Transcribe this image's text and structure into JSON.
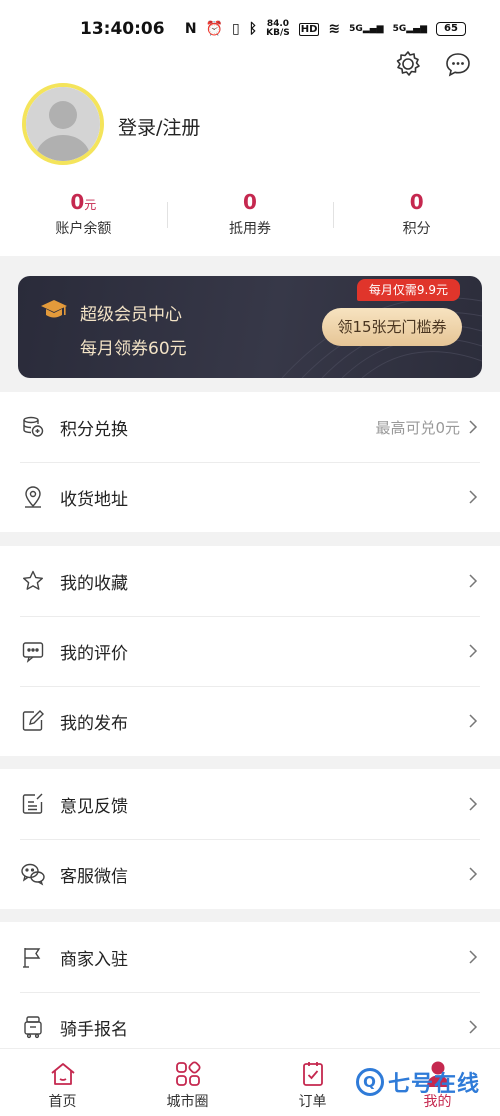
{
  "status": {
    "time": "13:40:06",
    "speed_top": "84.0",
    "speed_bottom": "KB/S",
    "network1": "5G",
    "network2": "5G",
    "battery": "65",
    "hd": "HD"
  },
  "profile": {
    "login_label": "登录/注册",
    "stats": [
      {
        "value": "0",
        "unit": "元",
        "label": "账户余额"
      },
      {
        "value": "0",
        "unit": "",
        "label": "抵用券"
      },
      {
        "value": "0",
        "unit": "",
        "label": "积分"
      }
    ]
  },
  "vip": {
    "title": "超级会员中心",
    "subtitle": "每月领券60元",
    "badge": "每月仅需9.9元",
    "button": "领15张无门槛券"
  },
  "groups": {
    "g1": [
      {
        "label": "积分兑换",
        "extra": "最高可兑0元",
        "icon": "coins-icon"
      },
      {
        "label": "收货地址",
        "extra": "",
        "icon": "location-icon"
      }
    ],
    "g2": [
      {
        "label": "我的收藏",
        "icon": "star-icon"
      },
      {
        "label": "我的评价",
        "icon": "comment-icon"
      },
      {
        "label": "我的发布",
        "icon": "edit-icon"
      }
    ],
    "g3": [
      {
        "label": "意见反馈",
        "icon": "feedback-icon"
      },
      {
        "label": "客服微信",
        "icon": "wechat-icon"
      }
    ],
    "g4": [
      {
        "label": "商家入驻",
        "icon": "flag-icon"
      },
      {
        "label": "骑手报名",
        "icon": "rider-icon"
      }
    ]
  },
  "nav": [
    {
      "label": "首页",
      "icon": "home-icon"
    },
    {
      "label": "城市圈",
      "icon": "city-circle-icon"
    },
    {
      "label": "订单",
      "icon": "order-icon"
    },
    {
      "label": "我的",
      "icon": "profile-icon"
    }
  ],
  "watermark": {
    "q": "Q",
    "text": "七号在线"
  },
  "colors": {
    "accent": "#c5284f",
    "vip_bg": "#2f3040",
    "vip_text": "#f3e3c6",
    "badge": "#e0352b"
  }
}
